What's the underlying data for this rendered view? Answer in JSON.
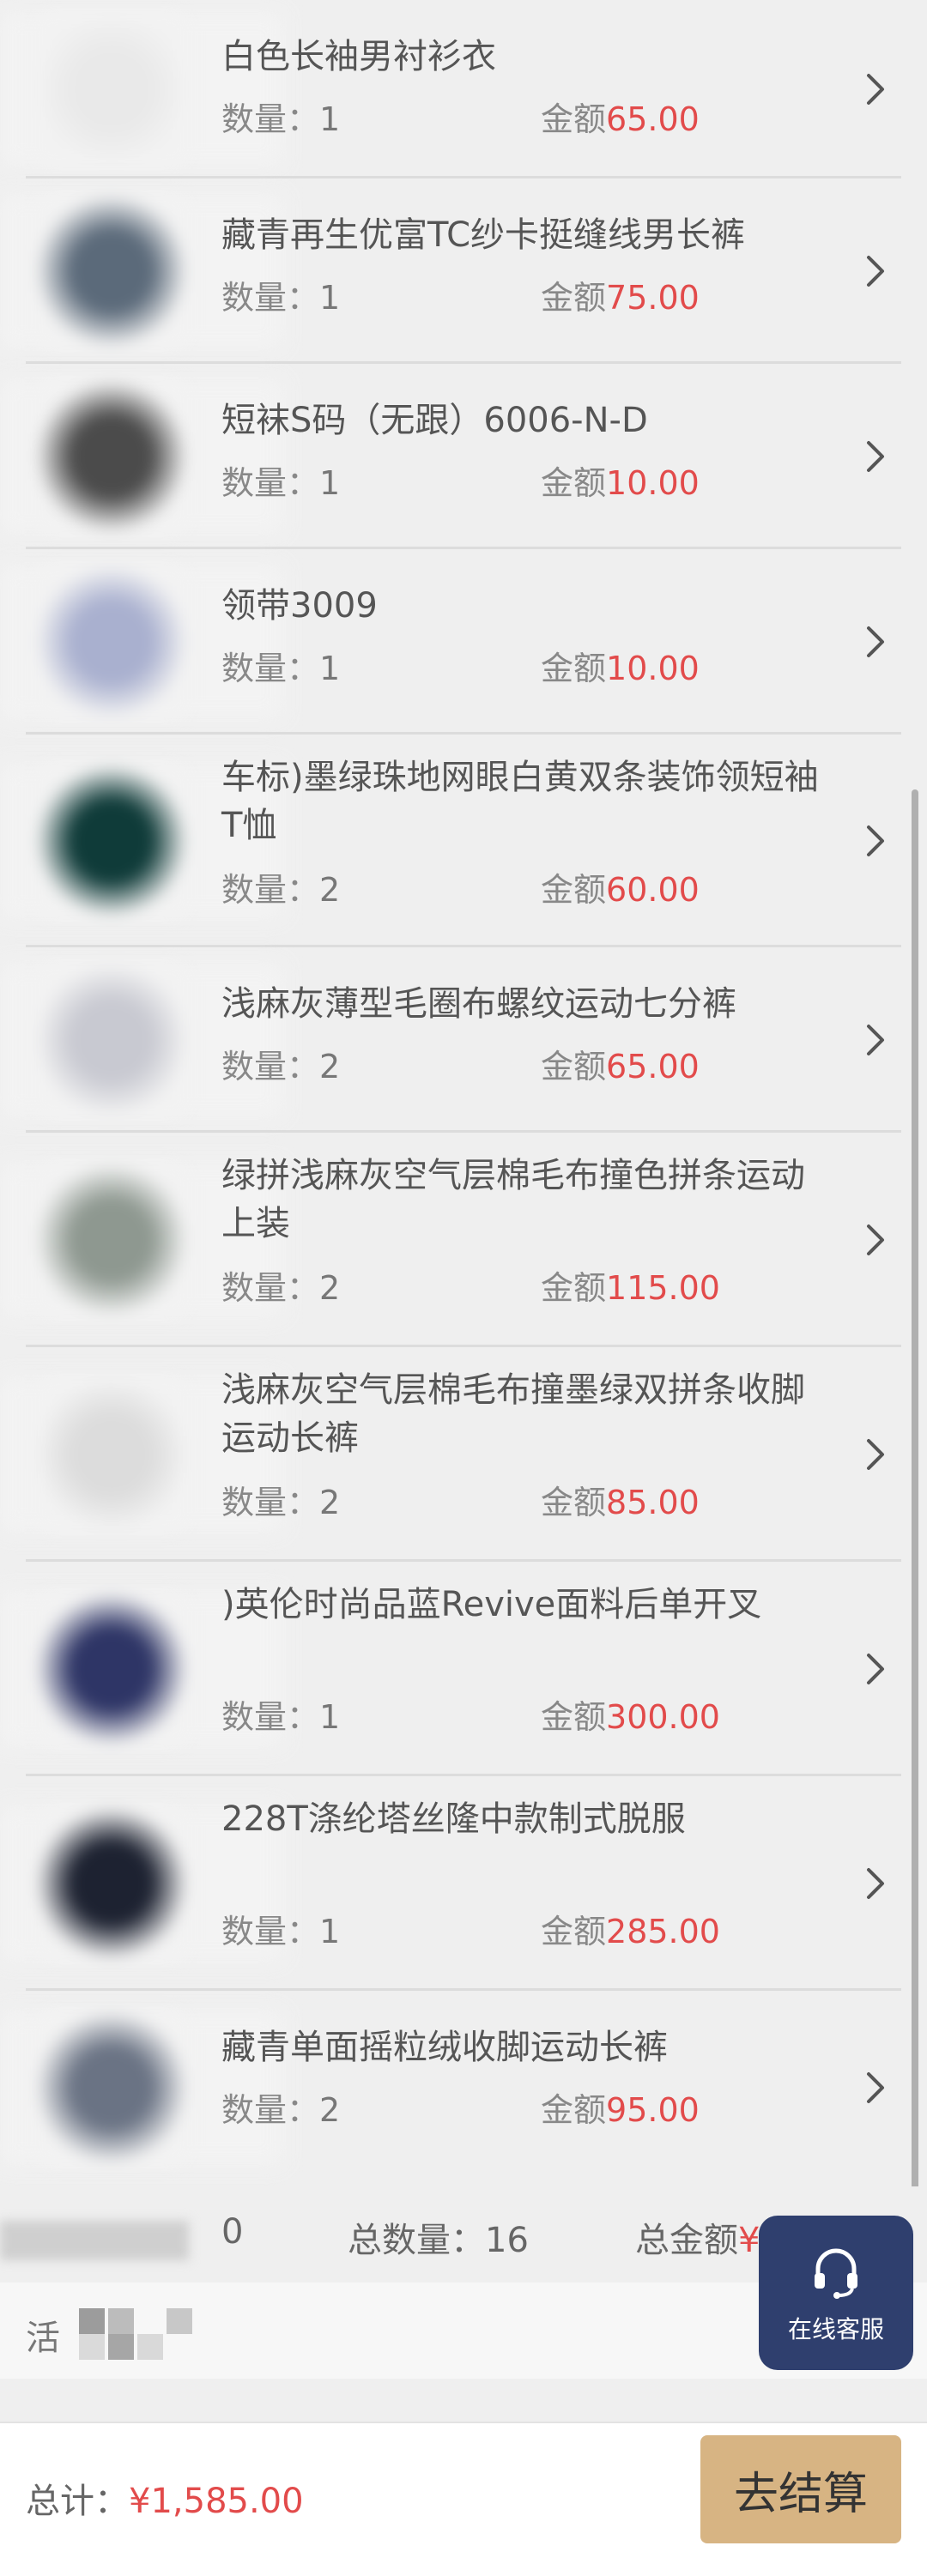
{
  "labels": {
    "qty_prefix": "数量：",
    "amount_prefix": "金额"
  },
  "items": [
    {
      "title": "白色长袖男衬衫衣",
      "qty": "1",
      "amount": "65.00",
      "color": "#e9e9e9"
    },
    {
      "title": "藏青再生优富TC纱卡挺缝线男长裤",
      "qty": "1",
      "amount": "75.00",
      "color": "#5b6a7a"
    },
    {
      "title": "短袜S码（无跟）6006-N-D",
      "qty": "1",
      "amount": "10.00",
      "color": "#4b4b4b"
    },
    {
      "title": "领带3009",
      "qty": "1",
      "amount": "10.00",
      "color": "#a9b0cf"
    },
    {
      "title": "车标)墨绿珠地网眼白黄双条装饰领短袖T恤",
      "qty": "2",
      "amount": "60.00",
      "color": "#0f3b39"
    },
    {
      "title": "浅麻灰薄型毛圈布螺纹运动七分裤",
      "qty": "2",
      "amount": "65.00",
      "color": "#c8c9d1"
    },
    {
      "title": "绿拼浅麻灰空气层棉毛布撞色拼条运动上装",
      "qty": "2",
      "amount": "115.00",
      "color": "#8e9890"
    },
    {
      "title": "浅麻灰空气层棉毛布撞墨绿双拼条收脚运动长裤",
      "qty": "2",
      "amount": "85.00",
      "color": "#dcdcdc"
    },
    {
      "title": ")英伦时尚品蓝Revive面料后单开叉",
      "qty": "1",
      "amount": "300.00",
      "color": "#2e3566"
    },
    {
      "title": "228T涤纶塔丝隆中款制式脱服",
      "qty": "1",
      "amount": "285.00",
      "color": "#1d2231"
    },
    {
      "title": "藏青单面摇粒绒收脚运动长裤",
      "qty": "2",
      "amount": "95.00",
      "color": "#6a7384"
    }
  ],
  "summary": {
    "zero": "0",
    "total_qty": "总数量：16",
    "total_amount_label": "总金额",
    "total_amount_value": "¥"
  },
  "promo": {
    "label": "活"
  },
  "bottom_bar": {
    "total_label": "总计：",
    "total_value": "¥1,585.00",
    "checkout_label": "去结算"
  },
  "customer_service": {
    "label": "在线客服",
    "icon": "headset-icon"
  }
}
